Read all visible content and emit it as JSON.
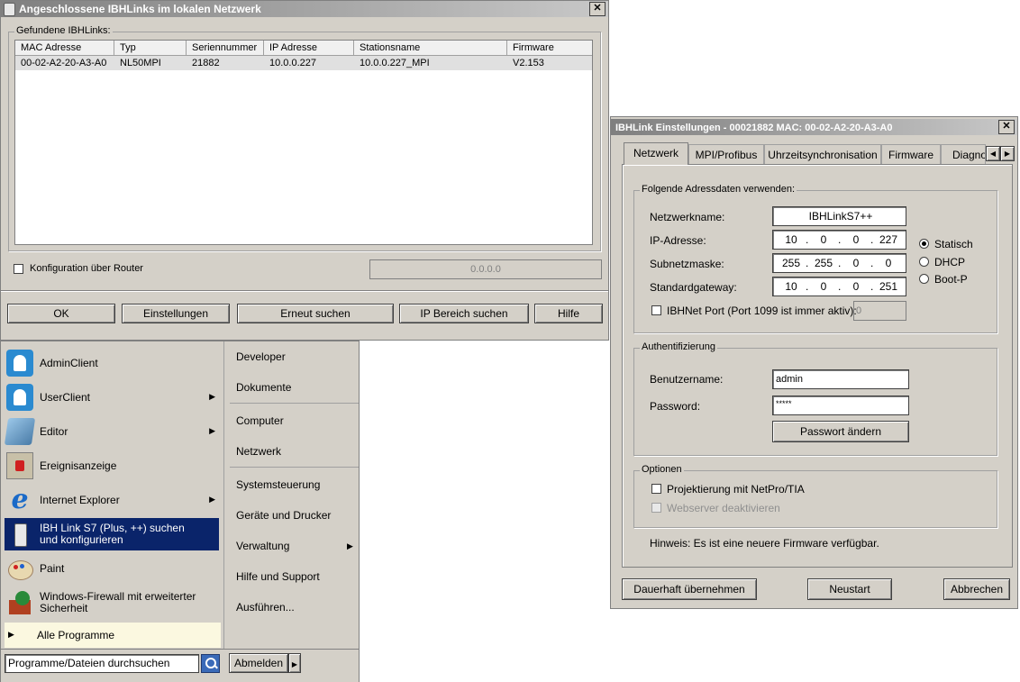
{
  "ibh_window": {
    "title": "Angeschlossene IBHLinks im lokalen Netzwerk",
    "close": "✕",
    "group_label": "Gefundene IBHLinks:",
    "columns": [
      "MAC Adresse",
      "Typ",
      "Seriennummer",
      "IP Adresse",
      "Stationsname",
      "Firmware"
    ],
    "rows": [
      [
        "00-02-A2-20-A3-A0",
        "NL50MPI",
        "21882",
        "10.0.0.227",
        "10.0.0.227_MPI",
        "V2.153"
      ]
    ],
    "router_label": "Konfiguration über Router",
    "router_ip": "0.0.0.0",
    "buttons": {
      "ok": "OK",
      "settings": "Einstellungen",
      "rescan": "Erneut suchen",
      "ip_range": "IP Bereich suchen",
      "help": "Hilfe"
    }
  },
  "start_menu": {
    "left_items": [
      {
        "label": "AdminClient",
        "icon": "admin-client-icon",
        "arrow": false
      },
      {
        "label": "UserClient",
        "icon": "user-client-icon",
        "arrow": true
      },
      {
        "label": "Editor",
        "icon": "editor-icon",
        "arrow": true
      },
      {
        "label": "Ereignisanzeige",
        "icon": "event-viewer-icon",
        "arrow": false
      },
      {
        "label": "Internet Explorer",
        "icon": "internet-explorer-icon",
        "arrow": true
      },
      {
        "label": "IBH Link S7 (Plus, ++) suchen und konfigurieren",
        "icon": "ibh-link-icon",
        "arrow": false,
        "selected": true
      },
      {
        "label": "Paint",
        "icon": "paint-icon",
        "arrow": false
      },
      {
        "label": "Windows-Firewall mit erweiterter Sicherheit",
        "icon": "firewall-icon",
        "arrow": false
      }
    ],
    "all_programs": "Alle Programme",
    "search_text": "Programme/Dateien durchsuchen",
    "right_items": [
      "Developer",
      "Dokumente",
      "Computer",
      "Netzwerk",
      "Systemsteuerung",
      "Geräte und Drucker",
      "Verwaltung",
      "Hilfe und Support",
      "Ausführen..."
    ],
    "logoff": "Abmelden"
  },
  "settings_window": {
    "title": "IBHLink Einstellungen - 00021882    MAC:  00-02-A2-20-A3-A0",
    "close": "✕",
    "tabs": [
      "Netzwerk",
      "MPI/Profibus",
      "Uhrzeitsynchronisation",
      "Firmware",
      "Diagno"
    ],
    "address_group": "Folgende Adressdaten verwenden:",
    "labels": {
      "netname": "Netzwerkname:",
      "ip": "IP-Adresse:",
      "mask": "Subnetzmaske:",
      "gateway": "Standardgateway:",
      "ibhnet": "IBHNet Port (Port 1099 ist immer aktiv):"
    },
    "netname": "IBHLinkS7++",
    "ip": [
      "10",
      "0",
      "0",
      "227"
    ],
    "mask": [
      "255",
      "255",
      "0",
      "0"
    ],
    "gateway": [
      "10",
      "0",
      "0",
      "251"
    ],
    "port": "0",
    "radio": [
      "Statisch",
      "DHCP",
      "Boot-P"
    ],
    "auth_group": "Authentifizierung",
    "user_label": "Benutzername:",
    "user": "admin",
    "pass_label": "Password:",
    "pass": "*****",
    "change_pass": "Passwort ändern",
    "options_group": "Optionen",
    "opt1": "Projektierung mit NetPro/TIA",
    "opt2": "Webserver deaktivieren",
    "hint": "Hinweis: Es ist eine neuere Firmware verfügbar.",
    "buttons": {
      "save": "Dauerhaft übernehmen",
      "restart": "Neustart",
      "cancel": "Abbrechen"
    }
  }
}
